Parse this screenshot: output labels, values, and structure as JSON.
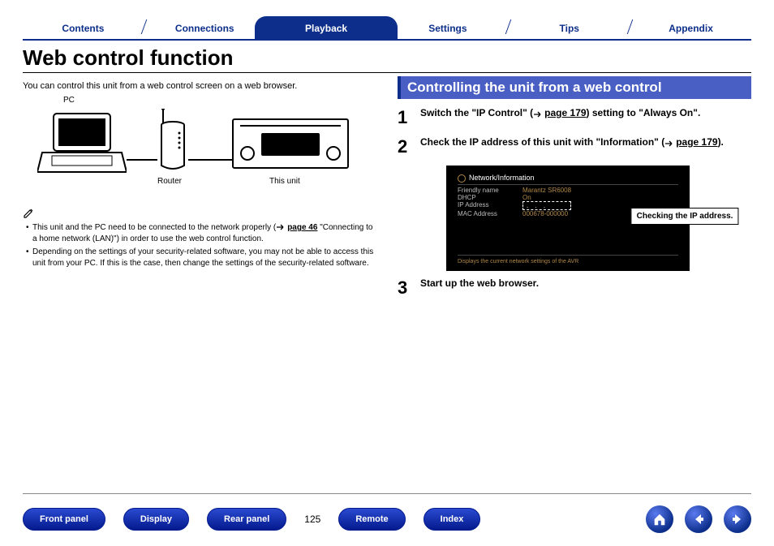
{
  "tabs": {
    "contents": "Contents",
    "connections": "Connections",
    "playback": "Playback",
    "settings": "Settings",
    "tips": "Tips",
    "appendix": "Appendix"
  },
  "title": "Web control function",
  "intro": "You can control this unit from a web control screen on a web browser.",
  "diagram": {
    "pc": "PC",
    "router": "Router",
    "unit": "This unit"
  },
  "notes": {
    "b1a": "This unit and the PC need to be connected to the network properly (",
    "b1_link": "page 46",
    "b1b": " \"Connecting to a home network (LAN)\") in order to use the web control function.",
    "b2": "Depending on the settings of your security-related software, you may not be able to access this unit from your PC. If this is the case, then change the settings of the security-related software."
  },
  "section_heading": "Controlling the unit from a web control",
  "steps": {
    "s1_a": "Switch the \"IP Control\" (",
    "s1_link": "page 179",
    "s1_b": ") setting to \"Always On\".",
    "s2_a": "Check the IP address of this unit with \"Information\" (",
    "s2_link": "page 179",
    "s2_b": ").",
    "s3": "Start up the web browser."
  },
  "netinfo": {
    "header": "Network/Information",
    "k_friendly": "Friendly name",
    "v_friendly": "Marantz SR6008",
    "k_dhcp": "DHCP",
    "v_dhcp": "On",
    "k_ip": "IP Address",
    "v_ip": ". . .",
    "k_mac": "MAC Address",
    "v_mac": "000678-000000",
    "footer": "Displays the current network settings of the AVR",
    "callout": "Checking the IP address."
  },
  "footer": {
    "front": "Front panel",
    "display": "Display",
    "rear": "Rear panel",
    "page": "125",
    "remote": "Remote",
    "index": "Index"
  }
}
